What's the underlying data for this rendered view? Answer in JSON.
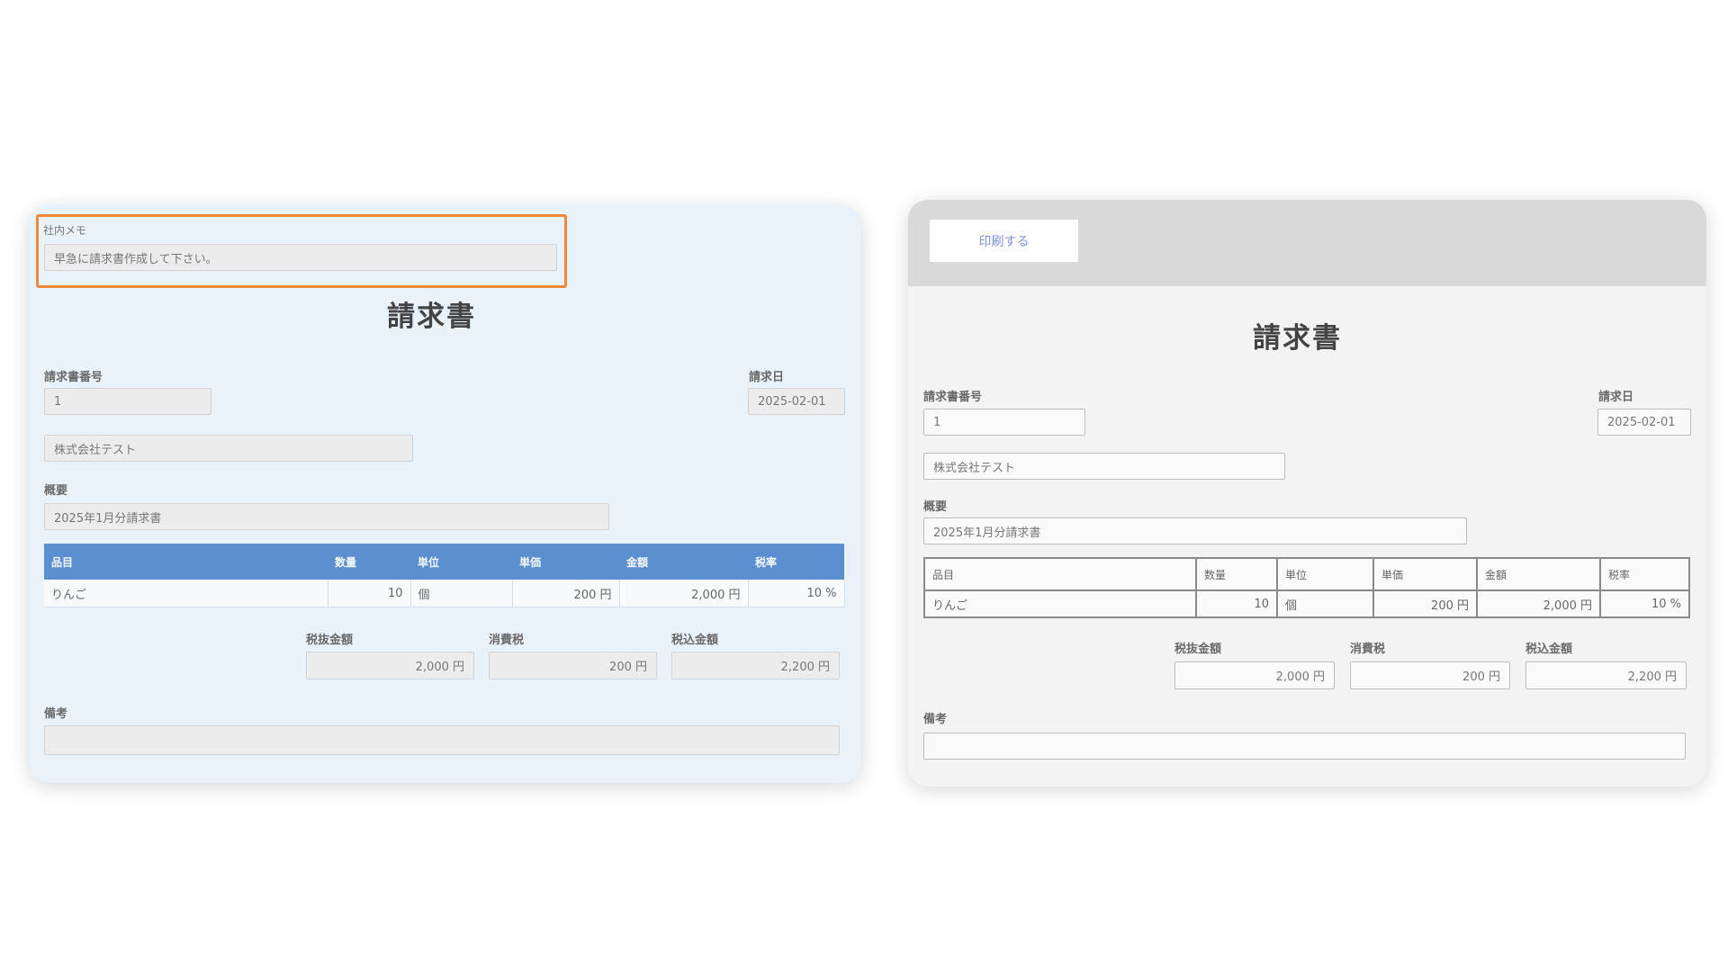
{
  "invoice": {
    "title": "請求書",
    "number_label": "請求書番号",
    "number_value": "1",
    "date_label": "請求日",
    "date_value": "2025-02-01",
    "customer_value": "株式会社テスト",
    "subject_label": "概要",
    "subject_value": "2025年1月分請求書",
    "table": {
      "headers": [
        "品目",
        "数量",
        "単位",
        "単価",
        "金額",
        "税率"
      ],
      "rows": [
        [
          "りんご",
          "10",
          "個",
          "200 円",
          "2,000 円",
          "10 %"
        ]
      ]
    },
    "subtotal_label": "税抜金額",
    "subtotal_value": "2,000 円",
    "tax_label": "消費税",
    "tax_value": "200 円",
    "total_label": "税込金額",
    "total_value": "2,200 円",
    "notes_label": "備考",
    "notes_value": ""
  },
  "memo": {
    "label": "社内メモ",
    "value": "早急に請求書作成して下さい。"
  },
  "print": {
    "button_label": "印刷する"
  },
  "colors": {
    "left_panel_bg": "#e9f1f9",
    "right_panel_bg": "#f3f3f3",
    "table_header_bg": "#5b8fd0",
    "memo_highlight": "#f08a3a",
    "print_bar_bg": "#d9d9d9",
    "print_button_text": "#7c93d6"
  }
}
